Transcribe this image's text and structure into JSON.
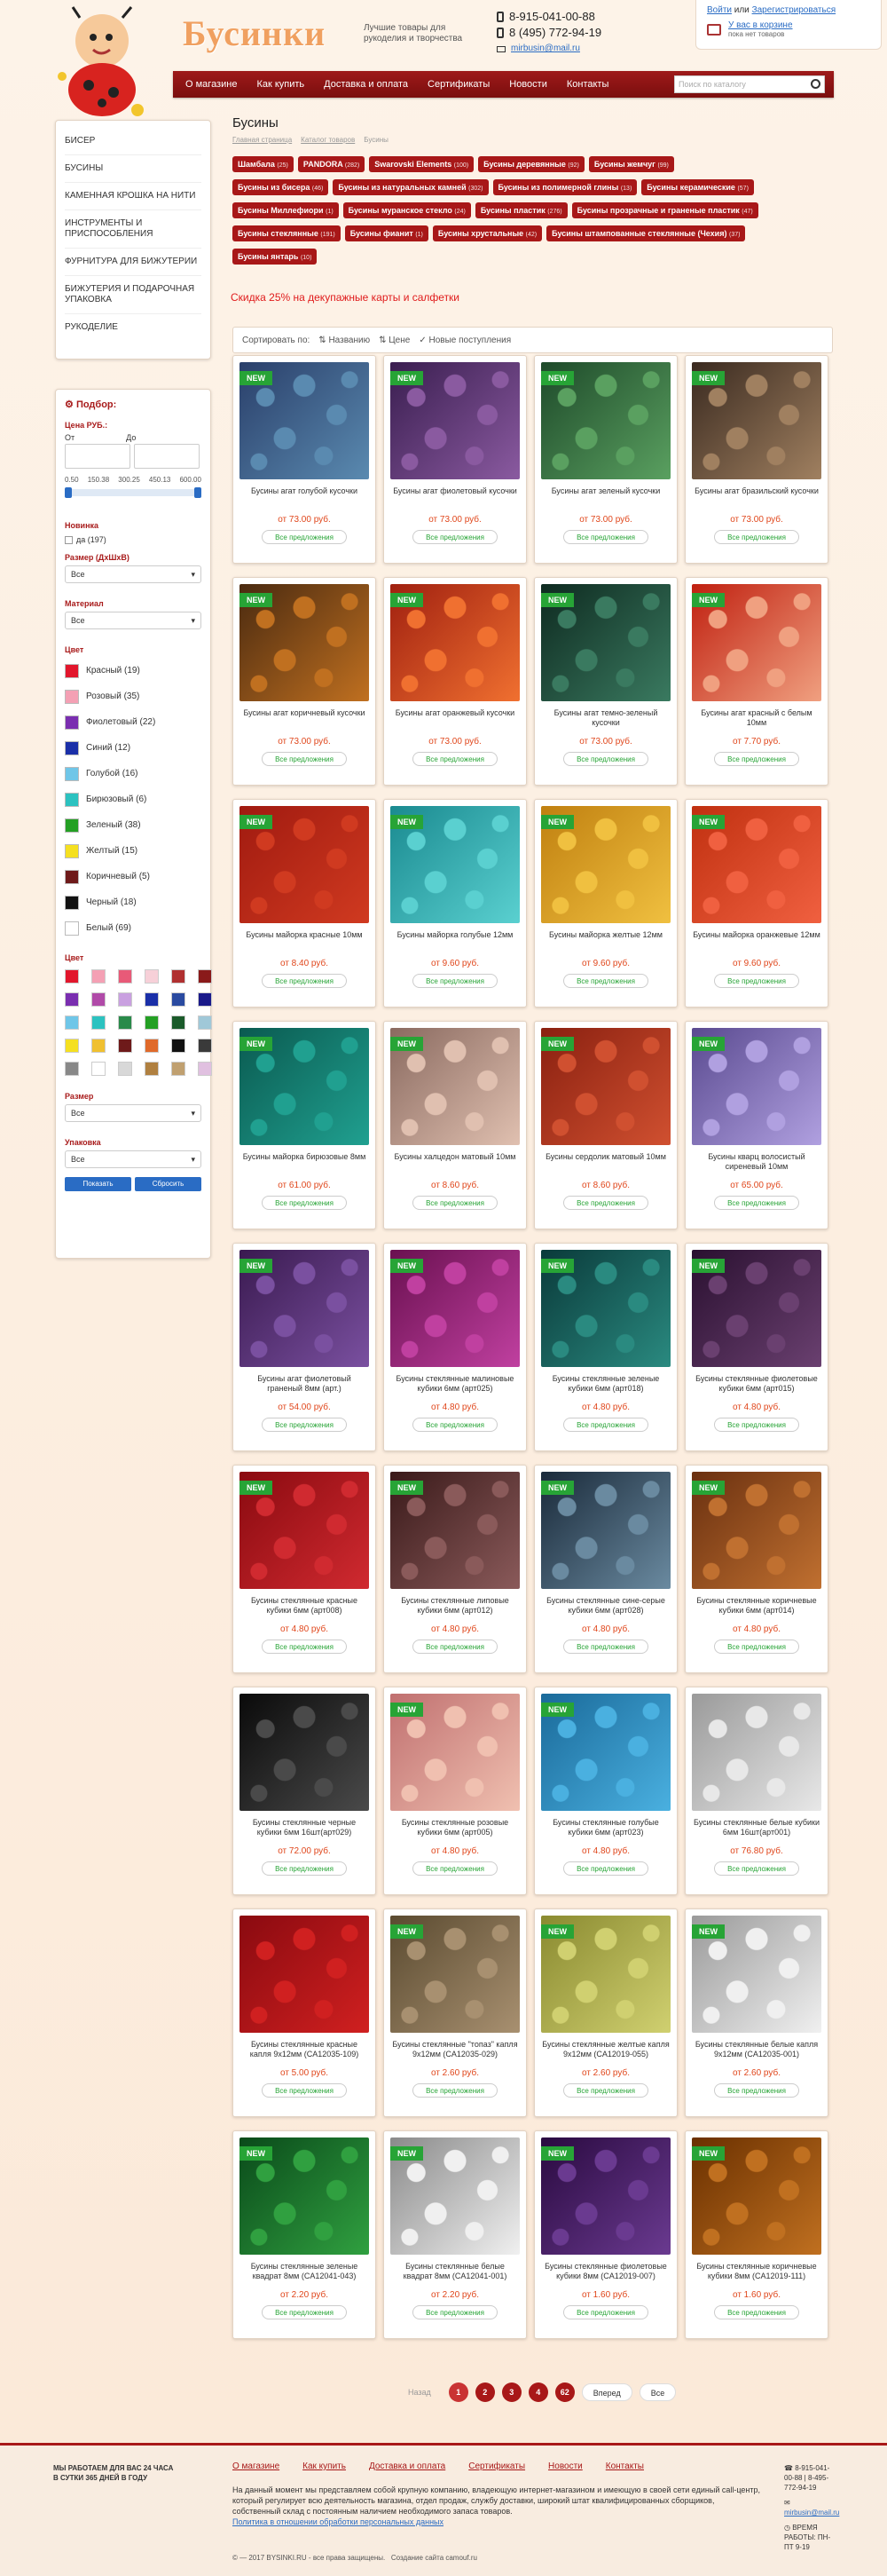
{
  "header": {
    "logo": "Бусинки",
    "slogan": "Лучшие товары для рукоделия и творчества",
    "phone1": "8-915-041-00-88",
    "phone2": "8 (495) 772-94-19",
    "email": "mirbusin@mail.ru",
    "login": "Войти",
    "or": "или",
    "register": "Зарегистрироваться",
    "cart_title": "У вас в корзине",
    "cart_status": "пока нет товаров"
  },
  "nav": {
    "items": [
      "О магазине",
      "Как купить",
      "Доставка и оплата",
      "Сертификаты",
      "Новости",
      "Контакты"
    ],
    "search_placeholder": "Поиск по каталогу"
  },
  "sidebar": {
    "categories": [
      "БИСЕР",
      "БУСИНЫ",
      "КАМЕННАЯ КРОШКА НА НИТИ",
      "ИНСТРУМЕНТЫ И ПРИСПОСОБЛЕНИЯ",
      "ФУРНИТУРА ДЛЯ БИЖУТЕРИИ",
      "БИЖУТЕРИЯ И ПОДАРОЧНАЯ УПАКОВКА",
      "РУКОДЕЛИЕ"
    ]
  },
  "filter": {
    "title": "Подбор:",
    "price_label": "Цена РУБ.:",
    "from": "От",
    "to": "До",
    "scale": [
      "0.50",
      "150.38",
      "300.25",
      "450.13",
      "600.00"
    ],
    "novelty_label": "Новинка",
    "novelty_value": "да (197)",
    "size_label": "Размер (ДхШхВ)",
    "size_value": "Все",
    "material_label": "Материал",
    "material_value": "Все",
    "color_label": "Цвет",
    "colors": [
      {
        "name": "Красный (19)",
        "hex": "#e2162c"
      },
      {
        "name": "Розовый (35)",
        "hex": "#f4a0b4"
      },
      {
        "name": "Фиолетовый (22)",
        "hex": "#7a2eb0"
      },
      {
        "name": "Синий (12)",
        "hex": "#1a2fa8"
      },
      {
        "name": "Голубой (16)",
        "hex": "#6fc6e8"
      },
      {
        "name": "Бирюзовый (6)",
        "hex": "#2cc2c0"
      },
      {
        "name": "Зеленый (38)",
        "hex": "#24a024"
      },
      {
        "name": "Желтый (15)",
        "hex": "#f5e020"
      },
      {
        "name": "Коричневый (5)",
        "hex": "#6e1a1a"
      },
      {
        "name": "Черный (18)",
        "hex": "#111111"
      },
      {
        "name": "Белый (69)",
        "hex": "#ffffff"
      }
    ],
    "color2_label": "Цвет",
    "swatches": [
      "#e2162c",
      "#f4a0b4",
      "#e85a78",
      "#f7d0d8",
      "#b03030",
      "#8a1a1a",
      "#7a2eb0",
      "#b04aa8",
      "#c9a0e0",
      "#1a2fa8",
      "#2a4aa0",
      "#1a1a8a",
      "#6fc6e8",
      "#2cc2c0",
      "#2a8a4a",
      "#24a024",
      "#1a5a2a",
      "#a0c8d8",
      "#f5e020",
      "#f0c030",
      "#6e1a1a",
      "#e06a2a",
      "#111111",
      "#3a3a3a",
      "#888888",
      "#ffffff",
      "#d8d8d8",
      "#b08040",
      "#c0a070",
      "#e0c0e0"
    ],
    "razmer_label": "Размер",
    "razmer_value": "Все",
    "pack_label": "Упаковка",
    "pack_value": "Все",
    "show": "Показать",
    "reset": "Сбросить"
  },
  "main": {
    "title": "Бусины",
    "crumbs": [
      "Главная страница",
      "Каталог товаров",
      "Бусины"
    ],
    "tags": [
      {
        "name": "Шамбала",
        "count": "(25)"
      },
      {
        "name": "PANDORA",
        "count": "(282)"
      },
      {
        "name": "Swarovski Elements",
        "count": "(100)"
      },
      {
        "name": "Бусины деревянные",
        "count": "(92)"
      },
      {
        "name": "Бусины жемчуг",
        "count": "(99)"
      },
      {
        "name": "Бусины из бисера",
        "count": "(46)"
      },
      {
        "name": "Бусины из натуральных камней",
        "count": "(302)"
      },
      {
        "name": "Бусины из полимерной глины",
        "count": "(13)"
      },
      {
        "name": "Бусины керамические",
        "count": "(57)"
      },
      {
        "name": "Бусины Миллефиори",
        "count": "(1)"
      },
      {
        "name": "Бусины муранское стекло",
        "count": "(24)"
      },
      {
        "name": "Бусины пластик",
        "count": "(276)"
      },
      {
        "name": "Бусины прозрачные и граненые пластик",
        "count": "(47)"
      },
      {
        "name": "Бусины стеклянные",
        "count": "(191)"
      },
      {
        "name": "Бусины фианит",
        "count": "(1)"
      },
      {
        "name": "Бусины хрустальные",
        "count": "(42)"
      },
      {
        "name": "Бусины штампованные стеклянные (Чехия)",
        "count": "(37)"
      },
      {
        "name": "Бусины янтарь",
        "count": "(10)"
      }
    ],
    "promo": "Скидка 25% на декупажные карты и салфетки",
    "sort_label": "Сортировать по:",
    "sort_options": [
      "Названию",
      "Цене",
      "Новые поступления"
    ],
    "new_badge": "NEW",
    "all_offers": "Все предложения"
  },
  "products": [
    {
      "name": "Бусины агат голубой кусочки",
      "price": "от 73.00 руб.",
      "new": true,
      "colors": [
        "#2a3f6a",
        "#5a8ab0"
      ]
    },
    {
      "name": "Бусины агат фиолетовый кусочки",
      "price": "от 73.00 руб.",
      "new": true,
      "colors": [
        "#3a1e50",
        "#8a5aa0"
      ]
    },
    {
      "name": "Бусины агат зеленый кусочки",
      "price": "от 73.00 руб.",
      "new": true,
      "colors": [
        "#1e4a2a",
        "#5aa060"
      ]
    },
    {
      "name": "Бусины агат бразильский кусочки",
      "price": "от 73.00 руб.",
      "new": true,
      "colors": [
        "#3a2a20",
        "#a08060"
      ]
    },
    {
      "name": "Бусины агат коричневый кусочки",
      "price": "от 73.00 руб.",
      "new": true,
      "colors": [
        "#4a2a10",
        "#c07020"
      ]
    },
    {
      "name": "Бусины агат оранжевый кусочки",
      "price": "от 73.00 руб.",
      "new": true,
      "colors": [
        "#a02010",
        "#f07030"
      ]
    },
    {
      "name": "Бусины агат темно-зеленый кусочки",
      "price": "от 73.00 руб.",
      "new": true,
      "colors": [
        "#0e2a20",
        "#3a7a60"
      ]
    },
    {
      "name": "Бусины агат красный с белым 10мм",
      "price": "от 7.70 руб.",
      "new": true,
      "colors": [
        "#c02010",
        "#f0a080"
      ]
    },
    {
      "name": "Бусины майорка красные 10мм",
      "price": "от 8.40 руб.",
      "new": true,
      "colors": [
        "#a01a10",
        "#d03a20"
      ]
    },
    {
      "name": "Бусины майорка голубые 12мм",
      "price": "от 9.60 руб.",
      "new": true,
      "colors": [
        "#1a8a90",
        "#5ad0d0"
      ]
    },
    {
      "name": "Бусины майорка желтые 12мм",
      "price": "от 9.60 руб.",
      "new": true,
      "colors": [
        "#c08010",
        "#f0c040"
      ]
    },
    {
      "name": "Бусины майорка оранжевые 12мм",
      "price": "от 9.60 руб.",
      "new": true,
      "colors": [
        "#c03010",
        "#f06040"
      ]
    },
    {
      "name": "Бусины майорка бирюзовые 8мм",
      "price": "от 61.00 руб.",
      "new": true,
      "colors": [
        "#0a5a50",
        "#20a090"
      ]
    },
    {
      "name": "Бусины халцедон матовый 10мм",
      "price": "от 8.60 руб.",
      "new": true,
      "colors": [
        "#8a6a60",
        "#e0c0b0"
      ]
    },
    {
      "name": "Бусины сердолик матовый 10мм",
      "price": "от 8.60 руб.",
      "new": true,
      "colors": [
        "#8a2010",
        "#d05030"
      ]
    },
    {
      "name": "Бусины кварц волосистый сиреневый 10мм",
      "price": "от 65.00 руб.",
      "new": true,
      "colors": [
        "#5a4a90",
        "#b0a0e0"
      ]
    },
    {
      "name": "Бусины агат фиолетовый граненый 8мм (арт.)",
      "price": "от 54.00 руб.",
      "new": true,
      "colors": [
        "#3a1a50",
        "#7a50a0"
      ]
    },
    {
      "name": "Бусины стеклянные малиновые кубики 6мм (арт025)",
      "price": "от 4.80 руб.",
      "new": true,
      "colors": [
        "#6a1050",
        "#c040a0"
      ]
    },
    {
      "name": "Бусины стеклянные зеленые кубики 6мм (арт018)",
      "price": "от 4.80 руб.",
      "new": true,
      "colors": [
        "#0a3a3a",
        "#2a8a80"
      ]
    },
    {
      "name": "Бусины стеклянные фиолетовые кубики 6мм (арт015)",
      "price": "от 4.80 руб.",
      "new": true,
      "colors": [
        "#2a1030",
        "#6a4070"
      ]
    },
    {
      "name": "Бусины стеклянные красные кубики 6мм (арт008)",
      "price": "от 4.80 руб.",
      "new": true,
      "colors": [
        "#8a0a10",
        "#d02a30"
      ]
    },
    {
      "name": "Бусины стеклянные липовые кубики 6мм (арт012)",
      "price": "от 4.80 руб.",
      "new": true,
      "colors": [
        "#3a1a1a",
        "#8a5a5a"
      ]
    },
    {
      "name": "Бусины стеклянные сине-серые кубики 6мм (арт028)",
      "price": "от 4.80 руб.",
      "new": true,
      "colors": [
        "#1a2a3a",
        "#6a8aa0"
      ]
    },
    {
      "name": "Бусины стеклянные коричневые кубики 6мм (арт014)",
      "price": "от 4.80 руб.",
      "new": true,
      "colors": [
        "#6a3010",
        "#c07030"
      ]
    },
    {
      "name": "Бусины стеклянные черные кубики 6мм 16шт(арт029)",
      "price": "от 72.00 руб.",
      "new": false,
      "colors": [
        "#0a0a0a",
        "#4a4a4a"
      ]
    },
    {
      "name": "Бусины стеклянные розовые кубики 6мм (арт005)",
      "price": "от 4.80 руб.",
      "new": true,
      "colors": [
        "#c07070",
        "#f0c0b0"
      ]
    },
    {
      "name": "Бусины стеклянные голубые кубики 6мм (арт023)",
      "price": "от 4.80 руб.",
      "new": true,
      "colors": [
        "#1a6a9a",
        "#4ab0e0"
      ]
    },
    {
      "name": "Бусины стеклянные белые кубики 6мм 16шт(арт001)",
      "price": "от 76.80 руб.",
      "new": false,
      "colors": [
        "#9a9a9a",
        "#e8e8e8"
      ]
    },
    {
      "name": "Бусины стеклянные красные капля 9х12мм (CA12035-109)",
      "price": "от 5.00 руб.",
      "new": false,
      "colors": [
        "#8a0a10",
        "#d02020"
      ]
    },
    {
      "name": "Бусины стеклянные \"топаз\" капля 9х12мм (CA12035-029)",
      "price": "от 2.60 руб.",
      "new": true,
      "colors": [
        "#5a4a30",
        "#a89070"
      ]
    },
    {
      "name": "Бусины стеклянные желтые капля 9х12мм (CA12019-055)",
      "price": "от 2.60 руб.",
      "new": true,
      "colors": [
        "#8a8a30",
        "#d0d070"
      ]
    },
    {
      "name": "Бусины стеклянные белые капля 9х12мм (CA12035-001)",
      "price": "от 2.60 руб.",
      "new": true,
      "colors": [
        "#9a9a9a",
        "#f0f0f0"
      ]
    },
    {
      "name": "Бусины стеклянные зеленые квадрат 8мм (CA12041-043)",
      "price": "от 2.20 руб.",
      "new": true,
      "colors": [
        "#0a4a1a",
        "#30a040"
      ]
    },
    {
      "name": "Бусины стеклянные белые квадрат 8мм (CA12041-001)",
      "price": "от 2.20 руб.",
      "new": true,
      "colors": [
        "#8a8a8a",
        "#f0f0f0"
      ]
    },
    {
      "name": "Бусины стеклянные фиолетовые кубики 8мм (CA12019-007)",
      "price": "от 1.60 руб.",
      "new": true,
      "colors": [
        "#2a0a40",
        "#6a3a90"
      ]
    },
    {
      "name": "Бусины стеклянные коричневые кубики 8мм (CA12019-111)",
      "price": "от 1.60 руб.",
      "new": true,
      "colors": [
        "#6a3000",
        "#c07020"
      ]
    }
  ],
  "pager": {
    "prev": "Назад",
    "pages": [
      "1",
      "2",
      "3",
      "4",
      "62"
    ],
    "next": "Вперед",
    "all": "Все"
  },
  "footer": {
    "hours": "МЫ РАБОТАЕМ ДЛЯ ВАС 24 ЧАСА В СУТКИ 365 ДНЕЙ В ГОДУ",
    "nav": [
      "О магазине",
      "Как купить",
      "Доставка и оплата",
      "Сертификаты",
      "Новости",
      "Контакты"
    ],
    "about": "На данный момент мы представляем собой крупную компанию, владеющую интернет-магазином и имеющую в своей сети единый call-центр, который регулирует всю деятельность магазина, отдел продаж, службу доставки, широкий штат квалифицированных сборщиков, собственный склад с постоянным наличием необходимого запаса товаров.",
    "policy": "Политика в отношении обработки персональных данных",
    "copyright": "© — 2017 BYSINKI.RU - все права защищены.",
    "created": "Создание сайта camouf.ru",
    "phone": "8-915-041-00-88 | 8-495-772-94-19",
    "email": "mirbusin@mail.ru",
    "worktime": "ВРЕМЯ РАБОТЫ: ПН-ПТ 9-19"
  }
}
